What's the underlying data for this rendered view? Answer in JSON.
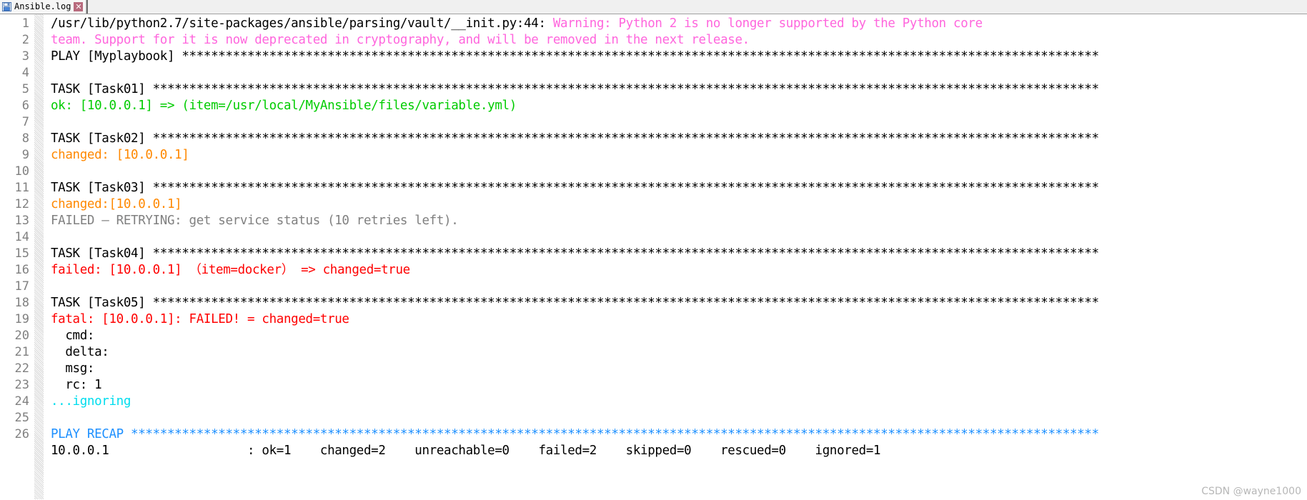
{
  "window": {
    "title": "Ansible.log"
  },
  "tab": {
    "label": "Ansible.log",
    "icon": "save-floppy-icon",
    "close_label": "✕"
  },
  "gutter": {
    "line_numbers": [
      "1",
      "2",
      "3",
      "4",
      "5",
      "6",
      "7",
      "8",
      "9",
      "10",
      "11",
      "12",
      "13",
      "14",
      "15",
      "16",
      "17",
      "18",
      "19",
      "20",
      "21",
      "22",
      "23",
      "24",
      "25",
      "26"
    ]
  },
  "colors": {
    "default": "#000000",
    "warning": "#ff66dd",
    "ok": "#00cc00",
    "changed": "#ff8800",
    "retry": "#808080",
    "failed": "#ff0000",
    "ignoring": "#00ddee",
    "recap": "#1e90ff",
    "lineno": "#808080",
    "tab_close_bg": "#b86a7d"
  },
  "watermark": {
    "text": "CSDN @wayne1000"
  },
  "lines": [
    {
      "n": 1,
      "segments": [
        {
          "text": "/usr/lib/python2.7/site-packages/ansible/parsing/vault/__init.py:44: ",
          "color": "default"
        },
        {
          "text": "Warning: Python 2 is no longer supported by the Python core",
          "color": "warning"
        }
      ]
    },
    {
      "n": 1,
      "continuation": true,
      "segments": [
        {
          "text": "team. Support for it is now deprecated in cryptography, and will be removed in the next release.",
          "color": "warning"
        }
      ]
    },
    {
      "n": 2,
      "segments": [
        {
          "text": "PLAY [Myplaybook] ******************************************************************************************************************************",
          "color": "default"
        }
      ]
    },
    {
      "n": 3,
      "segments": [
        {
          "text": "",
          "color": "default"
        }
      ]
    },
    {
      "n": 4,
      "segments": [
        {
          "text": "TASK [Task01] **********************************************************************************************************************************",
          "color": "default"
        }
      ]
    },
    {
      "n": 5,
      "segments": [
        {
          "text": "ok: [10.0.0.1] => (item=/usr/local/MyAnsible/files/variable.yml)",
          "color": "ok"
        }
      ]
    },
    {
      "n": 6,
      "segments": [
        {
          "text": "",
          "color": "default"
        }
      ]
    },
    {
      "n": 7,
      "segments": [
        {
          "text": "TASK [Task02] **********************************************************************************************************************************",
          "color": "default"
        }
      ]
    },
    {
      "n": 8,
      "segments": [
        {
          "text": "changed: [10.0.0.1]",
          "color": "changed"
        }
      ]
    },
    {
      "n": 9,
      "segments": [
        {
          "text": "",
          "color": "default"
        }
      ]
    },
    {
      "n": 10,
      "segments": [
        {
          "text": "TASK [Task03] **********************************************************************************************************************************",
          "color": "default"
        }
      ]
    },
    {
      "n": 11,
      "segments": [
        {
          "text": "changed:[10.0.0.1]",
          "color": "changed"
        }
      ]
    },
    {
      "n": 12,
      "segments": [
        {
          "text": "FAILED – RETRYING: get service status (10 retries left).",
          "color": "retry"
        }
      ]
    },
    {
      "n": 13,
      "segments": [
        {
          "text": "",
          "color": "default"
        }
      ]
    },
    {
      "n": 14,
      "segments": [
        {
          "text": "TASK [Task04] **********************************************************************************************************************************",
          "color": "default"
        }
      ]
    },
    {
      "n": 15,
      "segments": [
        {
          "text": "failed: [10.0.0.1] （item=docker） => changed=true",
          "color": "failed"
        }
      ]
    },
    {
      "n": 16,
      "segments": [
        {
          "text": "",
          "color": "default"
        }
      ]
    },
    {
      "n": 17,
      "segments": [
        {
          "text": "TASK [Task05] **********************************************************************************************************************************",
          "color": "default"
        }
      ]
    },
    {
      "n": 18,
      "segments": [
        {
          "text": "fatal: [10.0.0.1]: FAILED! = changed=true",
          "color": "failed"
        }
      ]
    },
    {
      "n": 19,
      "segments": [
        {
          "text": "  cmd:",
          "color": "default"
        }
      ]
    },
    {
      "n": 20,
      "segments": [
        {
          "text": "  delta:",
          "color": "default"
        }
      ]
    },
    {
      "n": 21,
      "segments": [
        {
          "text": "  msg:",
          "color": "default"
        }
      ]
    },
    {
      "n": 22,
      "segments": [
        {
          "text": "  rc: 1",
          "color": "default"
        }
      ]
    },
    {
      "n": 23,
      "segments": [
        {
          "text": "...ignoring",
          "color": "ignoring"
        }
      ]
    },
    {
      "n": 24,
      "segments": [
        {
          "text": "",
          "color": "default"
        }
      ]
    },
    {
      "n": 25,
      "segments": [
        {
          "text": "PLAY RECAP *************************************************************************************************************************************",
          "color": "recap"
        }
      ]
    },
    {
      "n": 26,
      "segments": [
        {
          "text": "10.0.0.1                   : ok=1    changed=2    unreachable=0    failed=2    skipped=0    rescued=0    ignored=1",
          "color": "default"
        }
      ]
    }
  ]
}
